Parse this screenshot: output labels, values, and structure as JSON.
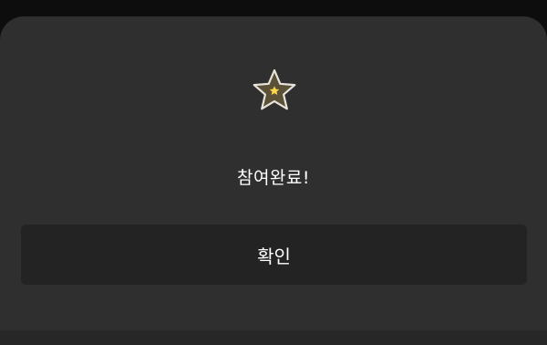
{
  "dialog": {
    "icon": "star-icon",
    "message": "참여완료!",
    "confirm_label": "확인"
  },
  "colors": {
    "background": "#0d0d0d",
    "sheet": "#2f2f2f",
    "button": "#232323",
    "text": "#ffffff",
    "star_fill": "#5a5136",
    "star_stroke": "#e7e3da",
    "star_center": "#ffd54a"
  }
}
